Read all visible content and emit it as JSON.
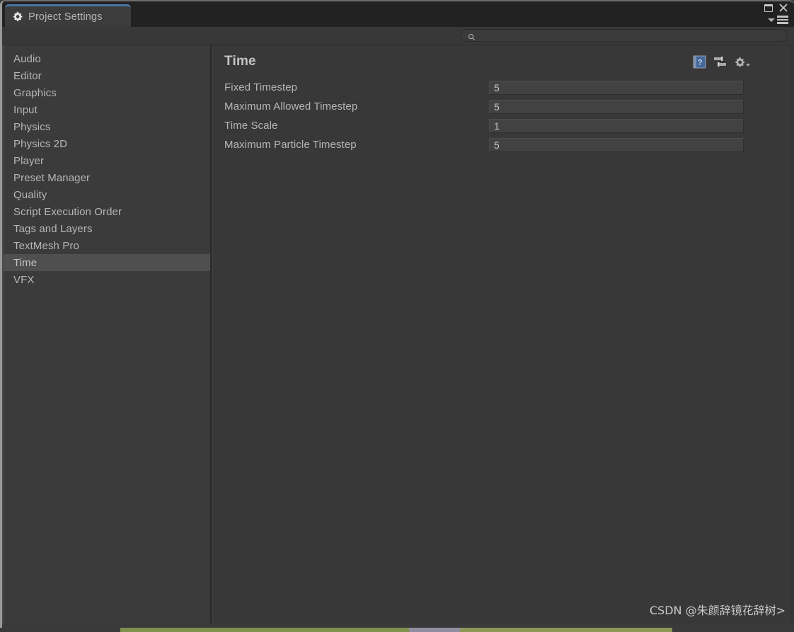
{
  "window": {
    "tab_label": "Project Settings",
    "tab_icon": "gear-icon",
    "tab_accent_color": "#4b74a8",
    "controls": {
      "maximize": "maximize-icon",
      "close": "close-icon",
      "menu": "hamburger-menu-icon",
      "menu_caret": "chevron-down-icon"
    }
  },
  "search": {
    "icon": "search-icon",
    "value": "",
    "placeholder": ""
  },
  "sidebar": {
    "items": [
      {
        "label": "Audio",
        "selected": false
      },
      {
        "label": "Editor",
        "selected": false
      },
      {
        "label": "Graphics",
        "selected": false
      },
      {
        "label": "Input",
        "selected": false
      },
      {
        "label": "Physics",
        "selected": false
      },
      {
        "label": "Physics 2D",
        "selected": false
      },
      {
        "label": "Player",
        "selected": false
      },
      {
        "label": "Preset Manager",
        "selected": false
      },
      {
        "label": "Quality",
        "selected": false
      },
      {
        "label": "Script Execution Order",
        "selected": false
      },
      {
        "label": "Tags and Layers",
        "selected": false
      },
      {
        "label": "TextMesh Pro",
        "selected": false
      },
      {
        "label": "Time",
        "selected": true
      },
      {
        "label": "VFX",
        "selected": false
      }
    ],
    "selected_color": "#4f4f4f"
  },
  "content": {
    "title": "Time",
    "header_icons": [
      {
        "name": "help-icon",
        "glyph": "?",
        "color": "#5b7fae"
      },
      {
        "name": "preset-selector-icon"
      },
      {
        "name": "settings-gear-icon"
      }
    ],
    "properties": [
      {
        "label": "Fixed Timestep",
        "value": "5"
      },
      {
        "label": "Maximum Allowed Timestep",
        "value": "5"
      },
      {
        "label": "Time Scale",
        "value": "1"
      },
      {
        "label": "Maximum Particle Timestep",
        "value": "5"
      }
    ]
  },
  "watermark": {
    "text": "CSDN @朱颜辞镜花辞树>"
  },
  "colors": {
    "window_bg": "#383838",
    "tabbar_bg": "#222222",
    "sidebar_bg": "#3b3b3b",
    "field_bg": "#424242",
    "text": "#b6b6b6",
    "accent_blue": "#4b74a8",
    "strip_green": "#82904f"
  }
}
